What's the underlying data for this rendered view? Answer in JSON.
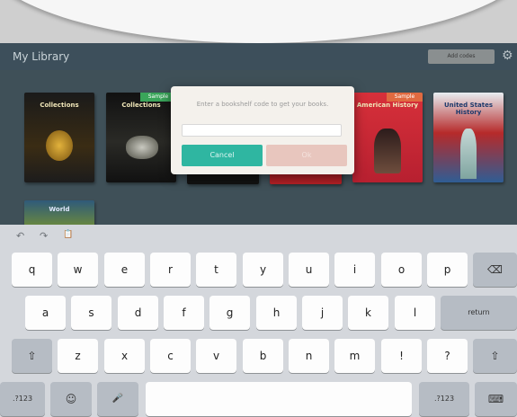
{
  "app": {
    "title": "My Library",
    "header_button": "Add codes",
    "gear": "⚙"
  },
  "books": [
    {
      "title": "Collections",
      "ribbon": ""
    },
    {
      "title": "Collections",
      "ribbon": "Sample"
    },
    {
      "title": "",
      "ribbon": ""
    },
    {
      "title": "",
      "ribbon": ""
    },
    {
      "title": "American History",
      "ribbon": "Sample"
    },
    {
      "title": "United States History",
      "ribbon": ""
    },
    {
      "title": "World",
      "ribbon": ""
    }
  ],
  "dialog": {
    "message": "Enter a bookshelf code to get your books.",
    "input_value": "",
    "cancel_label": "Cancel",
    "ok_label": "Ok"
  },
  "keyboard": {
    "toolbar": [
      "↶",
      "↷",
      "📋"
    ],
    "row1": [
      "q",
      "w",
      "e",
      "r",
      "t",
      "y",
      "u",
      "i",
      "o",
      "p"
    ],
    "backspace": "⌫",
    "row2": [
      "a",
      "s",
      "d",
      "f",
      "g",
      "h",
      "j",
      "k",
      "l"
    ],
    "return_label": "return",
    "shift_left": "⇧",
    "row3": [
      "z",
      "x",
      "c",
      "v",
      "b",
      "n",
      "m",
      "!",
      "?"
    ],
    "shift_right": "⇧",
    "num_left": ".?123",
    "emoji": "☺",
    "mic": "🎤",
    "space": "",
    "num_right": ".?123",
    "hide": "⌨"
  }
}
